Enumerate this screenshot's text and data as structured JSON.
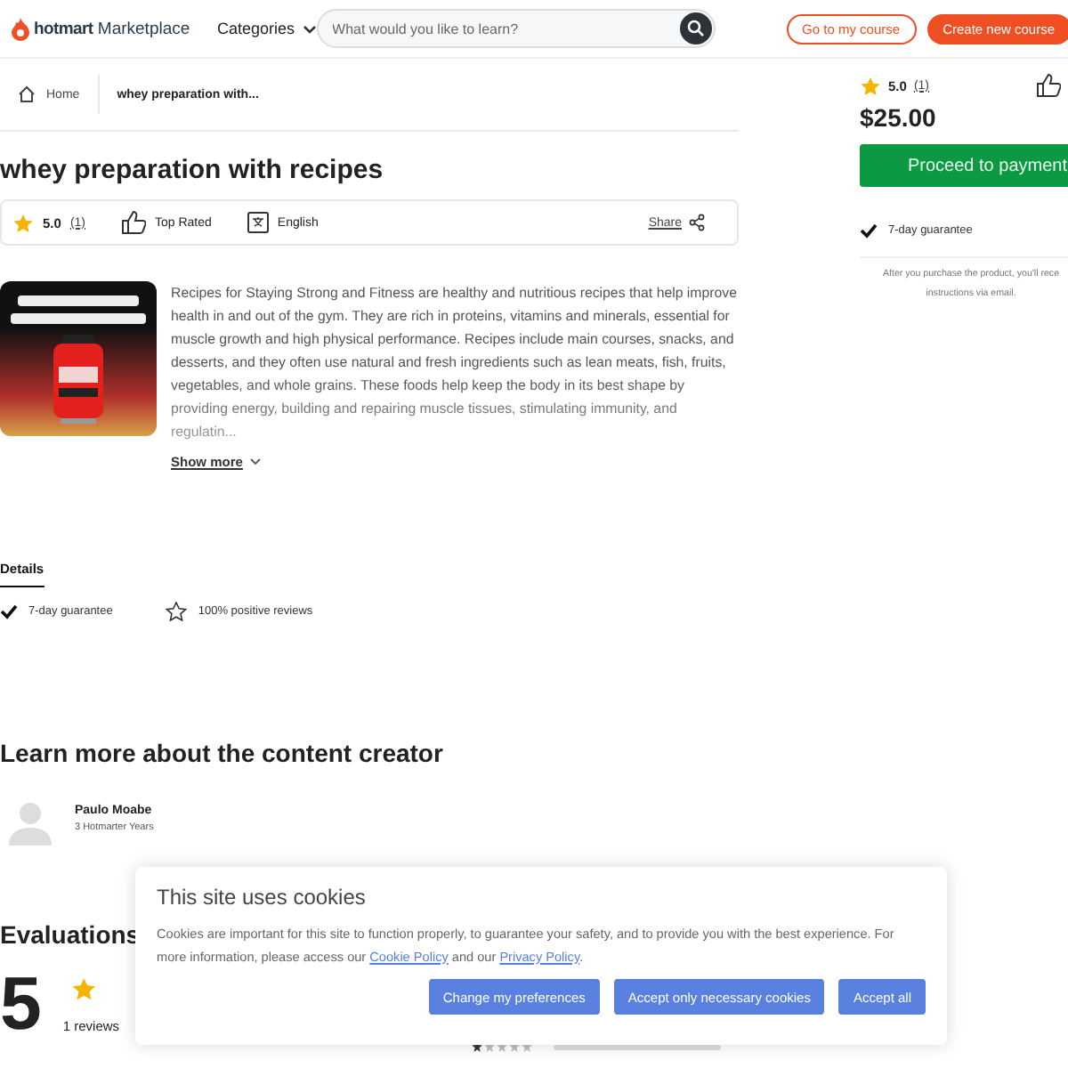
{
  "header": {
    "logo": "**hotmart** Marketplace",
    "categories": "Categories",
    "search": {
      "placeholder": "What would you like to learn?"
    },
    "buttons": [
      {
        "label": "Go to my course",
        "kind": "outline"
      },
      {
        "label": "Create new course",
        "kind": "filled"
      }
    ]
  },
  "breadcrumb": [
    {
      "label": "Home",
      "kind": "home"
    },
    {
      "label": "whey preparation with...",
      "kind": "current"
    }
  ],
  "product": {
    "title": "whey preparation with recipes",
    "rating": "5.0",
    "reviews_count": "(1)",
    "badge": "Top Rated",
    "language": "English",
    "share": "Share",
    "description": "Recipes for Staying Strong and Fitness are healthy and nutritious recipes that help improve health in and out of the gym. They are rich in proteins, vitamins and minerals, essential for muscle growth and high physical performance. Recipes include main courses, snacks, and desserts, and they often use natural and fresh ingredients such as lean meats, fish, fruits, vegetables, and whole grains. These foods help keep the body in its best shape by providing energy, building and repairing muscle tissues, stimulating immunity, and regulatin...",
    "show_more": "Show more"
  },
  "tabs": [
    {
      "label": "Details",
      "selected": true
    }
  ],
  "details": [
    {
      "kind": "check",
      "text": "7-day guarantee"
    },
    {
      "kind": "star",
      "text": "100% positive reviews"
    }
  ],
  "creator": {
    "heading": "Learn more about the content creator",
    "name": "Paulo Moabe",
    "years": "3 Hotmarter Years"
  },
  "evaluations": {
    "heading": "Evaluations",
    "score": "5",
    "reviews": "1 reviews",
    "breakdown": [
      {
        "stars": 1
      }
    ]
  },
  "purchase": {
    "rating": "5.0",
    "reviews_count": "(1)",
    "price": "$25.00",
    "button": "Proceed to payment",
    "guarantee": "7-day guarantee",
    "note": [
      "After you purchase the product, you'll rece",
      "instructions via email."
    ]
  },
  "cookies": {
    "title": "This site uses cookies",
    "text": "Cookies are important for this site to function properly, to guarantee your safety, and to provide you with the best experience. For more information, please access our ",
    "links": [
      "Cookie Policy",
      "Privacy Policy"
    ],
    "joiner": " and our ",
    "end": ".",
    "buttons": [
      "Change my preferences",
      "Accept only necessary cookies",
      "Accept all"
    ]
  }
}
